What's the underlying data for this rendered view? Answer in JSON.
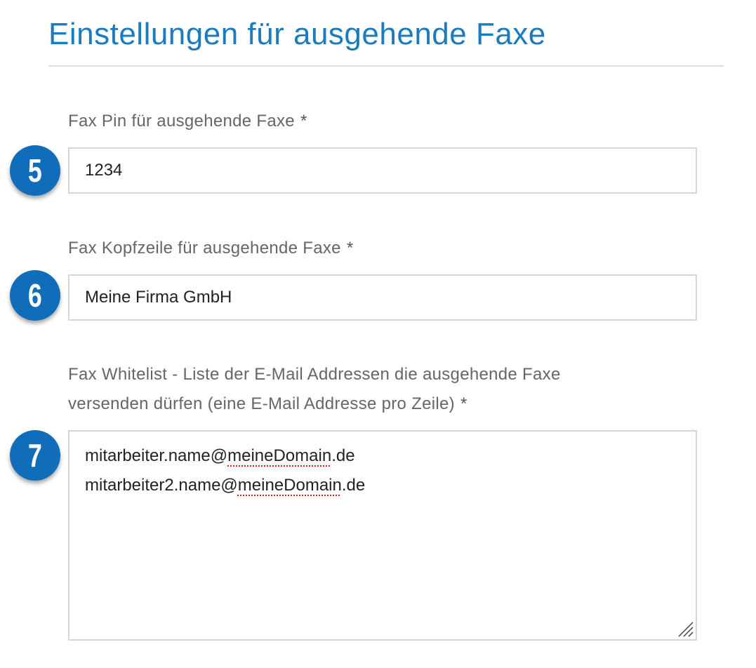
{
  "section": {
    "title": "Einstellungen für ausgehende Faxe"
  },
  "fields": {
    "pin": {
      "step": "5",
      "label": "Fax Pin für ausgehende Faxe",
      "required_mark": "*",
      "value": "1234"
    },
    "header": {
      "step": "6",
      "label": "Fax Kopfzeile für ausgehende Faxe",
      "required_mark": "*",
      "value": "Meine Firma GmbH"
    },
    "whitelist": {
      "step": "7",
      "label_line1": "Fax Whitelist - Liste der E-Mail Addressen die ausgehende Faxe",
      "label_line2": "versenden dürfen (eine E-Mail Addresse pro Zeile)",
      "required_mark": "*",
      "lines": [
        {
          "prefix": "mitarbeiter.name@",
          "flagged": "meineDomain",
          "suffix": ".de"
        },
        {
          "prefix": "mitarbeiter2.name@",
          "flagged": "meineDomain",
          "suffix": ".de"
        }
      ]
    }
  },
  "colors": {
    "accent": "#1a7bbf",
    "badge": "#0f6dba",
    "spellcheck": "#e02020"
  },
  "icons": {
    "resize": "resize-grip-icon"
  }
}
